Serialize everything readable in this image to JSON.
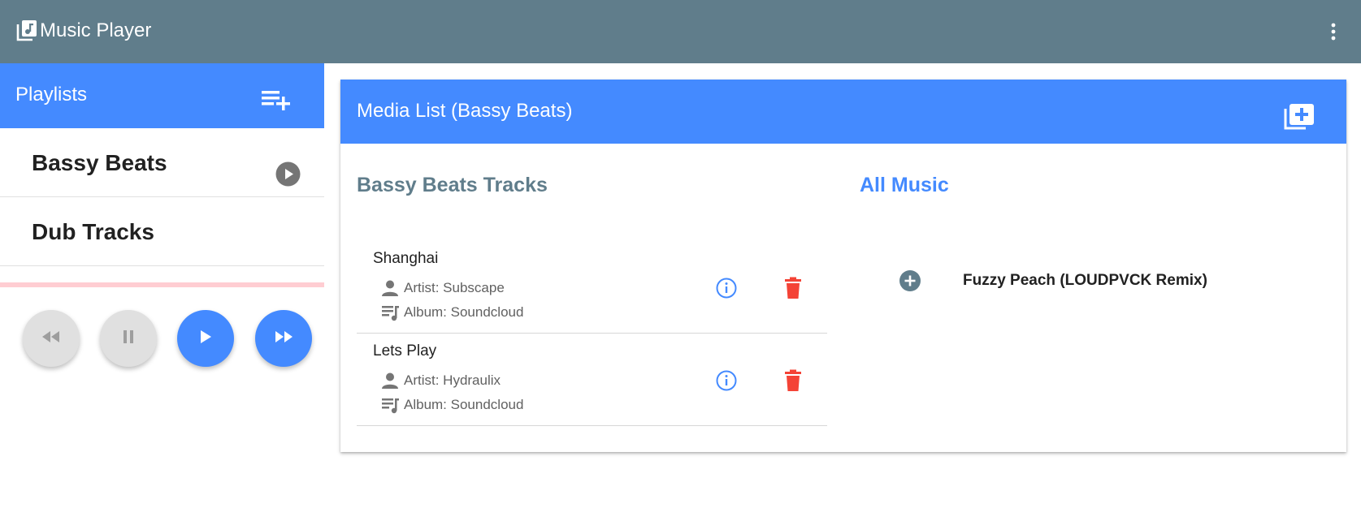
{
  "app": {
    "title": "Music Player",
    "icon": "library-music-icon",
    "menu_icon": "more-vert-icon"
  },
  "sidebar": {
    "title": "Playlists",
    "add_icon": "playlist-add-icon",
    "playlists": [
      {
        "name": "Bassy Beats",
        "icon": "play-circle-icon"
      },
      {
        "name": "Dub Tracks"
      }
    ],
    "progress": 0
  },
  "controls": {
    "rewind": {
      "icon": "fast-rewind-icon",
      "enabled": false
    },
    "pause": {
      "icon": "pause-icon",
      "enabled": false
    },
    "play": {
      "icon": "play-icon",
      "enabled": true
    },
    "forward": {
      "icon": "fast-forward-icon",
      "enabled": true
    }
  },
  "media": {
    "title": "Media List (Bassy Beats)",
    "add_icon": "library-add-icon",
    "tracks_title": "Bassy Beats Tracks",
    "all_title": "All Music",
    "tracks": [
      {
        "name": "Shanghai",
        "artist": "Artist: Subscape",
        "album": "Album: Soundcloud"
      },
      {
        "name": "Lets Play",
        "artist": "Artist: Hydraulix",
        "album": "Album: Soundcloud"
      }
    ],
    "all_music": [
      {
        "name": "Fuzzy Peach (LOUDPVCK Remix)"
      }
    ]
  },
  "colors": {
    "toolbar": "#607d8b",
    "primary": "#448aff",
    "delete": "#f44336",
    "progress_track": "#ffcdd2"
  }
}
